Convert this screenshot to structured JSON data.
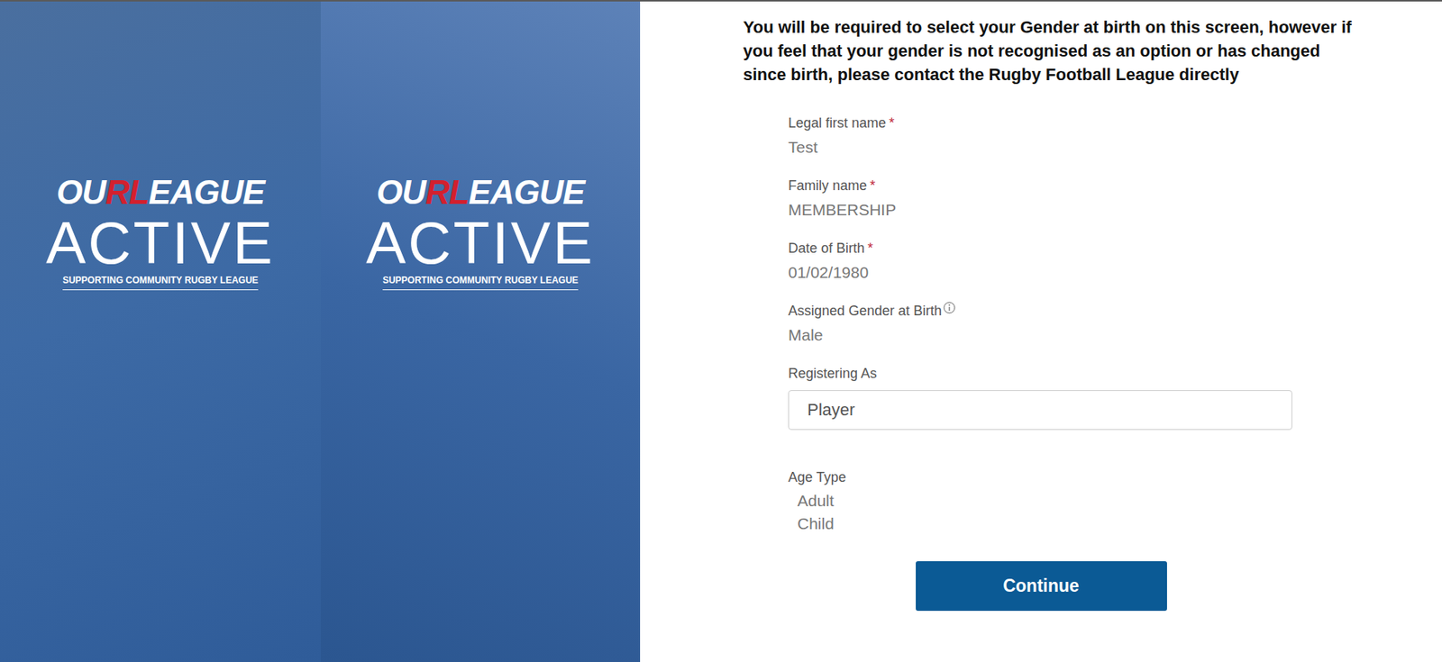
{
  "notice": "You will be required to select your Gender at birth on this screen, however if you feel that your gender is not recognised as an option or has changed since birth, please contact the Rugby Football League directly",
  "brand": {
    "first_a": "OU",
    "first_accent": "RL",
    "first_b": "EAGUE",
    "second": "ACTIVE",
    "tagline": "SUPPORTING COMMUNITY RUGBY LEAGUE"
  },
  "required_mark": "*",
  "fields": [
    {
      "label": "Legal first name",
      "value": "Test",
      "required": true,
      "info": false
    },
    {
      "label": "Family name",
      "value": "MEMBERSHIP",
      "required": true,
      "info": false
    },
    {
      "label": "Date of Birth",
      "value": "01/02/1980",
      "required": true,
      "info": false
    },
    {
      "label": "Assigned Gender at Birth",
      "value": "Male",
      "required": false,
      "info": true
    }
  ],
  "registering_as": {
    "label": "Registering As",
    "value": "Player"
  },
  "age_type": {
    "label": "Age Type",
    "options": [
      {
        "label": "Adult",
        "selected": false
      },
      {
        "label": "Child",
        "selected": false
      }
    ]
  },
  "buttons": [
    "Continue"
  ]
}
